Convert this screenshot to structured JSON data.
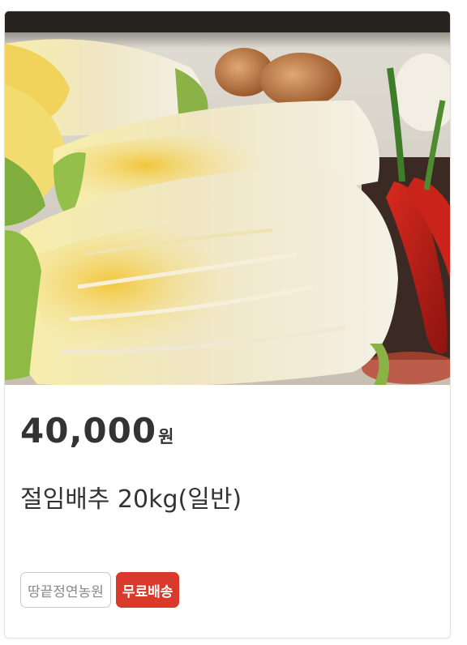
{
  "product": {
    "image_alt": "cabbage-photo",
    "price_amount": "40,000",
    "price_unit": "원",
    "title": "절임배추 20kg(일반)",
    "tags": {
      "seller": "땅끝정연농원",
      "shipping": "무료배송"
    },
    "colors": {
      "shipping_badge": "#d93a2b",
      "text": "#333333"
    }
  }
}
